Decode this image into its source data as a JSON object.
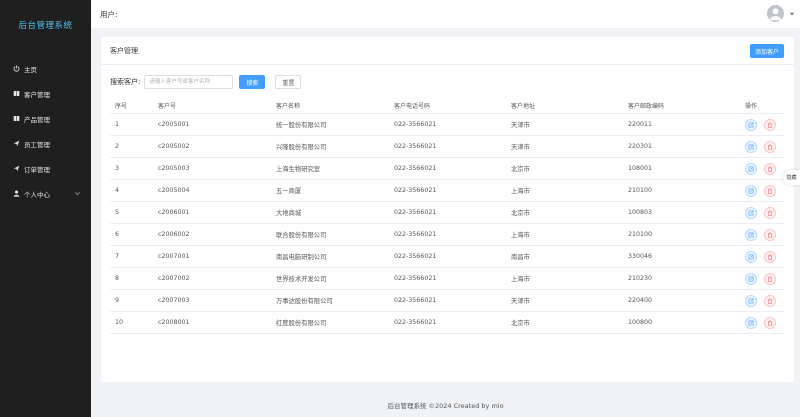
{
  "app": {
    "title": "后台管理系统"
  },
  "sidebar": {
    "items": [
      {
        "label": "主页",
        "icon": "power-icon"
      },
      {
        "label": "客户管理",
        "icon": "book-icon"
      },
      {
        "label": "产品管理",
        "icon": "book-icon"
      },
      {
        "label": "员工管理",
        "icon": "send-icon"
      },
      {
        "label": "订单管理",
        "icon": "send-icon"
      },
      {
        "label": "个人中心",
        "icon": "user-icon"
      }
    ]
  },
  "header": {
    "user_label": "用户:"
  },
  "card": {
    "title": "客户管理",
    "add_label": "添加客户"
  },
  "search": {
    "label": "搜索客户:",
    "placeholder": "请输入客户号或客户名称",
    "search_label": "搜索",
    "reset_label": "重置"
  },
  "table": {
    "headers": [
      "序号",
      "客户号",
      "客户名称",
      "客户电话号码",
      "客户地址",
      "客户邮政编码",
      "操作"
    ],
    "rows": [
      [
        "1",
        "c2005001",
        "统一股份有限公司",
        "022-3566021",
        "天津市",
        "220011"
      ],
      [
        "2",
        "c2005002",
        "兴隆股份有限公司",
        "022-3566021",
        "天津市",
        "220301"
      ],
      [
        "3",
        "c2005003",
        "上海生物研究室",
        "022-3566021",
        "北京市",
        "108001"
      ],
      [
        "4",
        "c2005004",
        "五一商厦",
        "022-3566021",
        "上海市",
        "210100"
      ],
      [
        "5",
        "c2006001",
        "大地商城",
        "022-3566021",
        "北京市",
        "100803"
      ],
      [
        "6",
        "c2006002",
        "联合股份有限公司",
        "022-3566021",
        "上海市",
        "210100"
      ],
      [
        "7",
        "c2007001",
        "南昌电脑研制公司",
        "022-3566021",
        "南昌市",
        "330046"
      ],
      [
        "8",
        "c2007002",
        "世界技术开发公司",
        "022-3566021",
        "上海市",
        "210230"
      ],
      [
        "9",
        "c2007003",
        "万事达股份有限公司",
        "022-3566021",
        "天津市",
        "220400"
      ],
      [
        "10",
        "c2008001",
        "红度股份有限公司",
        "022-3566021",
        "北京市",
        "100800"
      ]
    ]
  },
  "side_tag": "隐藏",
  "footer": "后台管理系统 ©2024 Created by mio",
  "colors": {
    "primary": "#409eff",
    "sidebar_bg": "#1f1f1f",
    "brand": "#4fc3f7",
    "danger": "#f56c6c"
  }
}
